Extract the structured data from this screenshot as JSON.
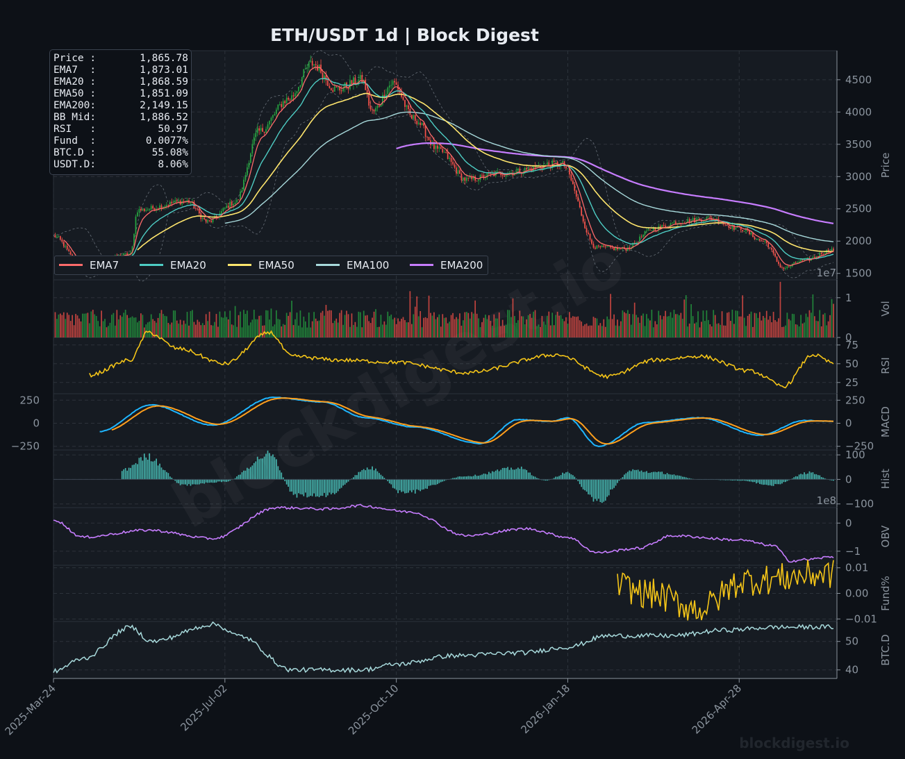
{
  "title": "ETH/USDT  1d  |  Block Digest",
  "watermark": "blockdigest.io",
  "footer": "blockdigest.io",
  "info_box": [
    {
      "key": "Price :",
      "value": "1,865.78"
    },
    {
      "key": "EMA7  :",
      "value": "1,873.01"
    },
    {
      "key": "EMA20 :",
      "value": "1,868.59"
    },
    {
      "key": "EMA50 :",
      "value": "1,851.09"
    },
    {
      "key": "EMA200:",
      "value": "2,149.15"
    },
    {
      "key": "BB Mid:",
      "value": "1,886.52"
    },
    {
      "key": "RSI   :",
      "value": "50.97"
    },
    {
      "key": "Fund  :",
      "value": "0.0077%"
    },
    {
      "key": "BTC.D :",
      "value": "55.08%"
    },
    {
      "key": "USDT.D:",
      "value": "8.06%"
    }
  ],
  "legend": [
    {
      "name": "EMA7",
      "color": "#ff6b6b"
    },
    {
      "name": "EMA20",
      "color": "#4ecdc4"
    },
    {
      "name": "EMA50",
      "color": "#ffe66d"
    },
    {
      "name": "EMA100",
      "color": "#a8dadc"
    },
    {
      "name": "EMA200",
      "color": "#c77dff"
    }
  ],
  "colors": {
    "up": "#26a641",
    "down": "#f85149",
    "rsi": "#f5c518",
    "macd": "#1fb6ff",
    "signal": "#ff9f1c",
    "hist": "#4ecdc4",
    "obv": "#c77dff",
    "funding": "#f5c518",
    "btcd": "#a8dadc",
    "grid": "#2d333b",
    "axis": "#8b949e",
    "panel": "#161b22",
    "background": "#0d1117"
  },
  "chart_data": {
    "type": "candlestick",
    "symbol": "ETH/USDT",
    "interval": "1d",
    "x_ticks": [
      "2025-Mar-24",
      "2025-Jul-02",
      "2025-Oct-10",
      "2026-Jan-18",
      "2026-Apr-28"
    ],
    "x_start": "2025-03-24",
    "x_end": "2026-06-22",
    "price_anchors": [
      [
        "2025-03-24",
        2080
      ],
      [
        "2025-04-10",
        1600
      ],
      [
        "2025-05-08",
        1800
      ],
      [
        "2025-05-12",
        2480
      ],
      [
        "2025-06-10",
        2620
      ],
      [
        "2025-06-22",
        2300
      ],
      [
        "2025-07-08",
        2600
      ],
      [
        "2025-07-22",
        3700
      ],
      [
        "2025-08-08",
        4200
      ],
      [
        "2025-08-22",
        4750
      ],
      [
        "2025-09-05",
        4350
      ],
      [
        "2025-09-20",
        4500
      ],
      [
        "2025-09-26",
        4000
      ],
      [
        "2025-10-08",
        4450
      ],
      [
        "2025-10-20",
        3900
      ],
      [
        "2025-11-04",
        3400
      ],
      [
        "2025-11-20",
        2950
      ],
      [
        "2025-12-10",
        3050
      ],
      [
        "2026-01-14",
        3200
      ],
      [
        "2026-02-04",
        1900
      ],
      [
        "2026-02-20",
        1880
      ],
      [
        "2026-03-10",
        2200
      ],
      [
        "2026-03-24",
        2300
      ],
      [
        "2026-04-10",
        2350
      ],
      [
        "2026-04-28",
        2200
      ],
      [
        "2026-05-12",
        2000
      ],
      [
        "2026-05-24",
        1580
      ],
      [
        "2026-06-04",
        1700
      ],
      [
        "2026-06-22",
        1866
      ]
    ],
    "panels": [
      {
        "name": "Price",
        "ylabel": "Price",
        "yticks": [
          1500,
          2000,
          2500,
          3000,
          3500,
          4000,
          4500
        ],
        "ylim": [
          1400,
          4950
        ],
        "series": [
          "Candles",
          "EMA7",
          "EMA20",
          "EMA50",
          "EMA100",
          "EMA200",
          "Bollinger Bands"
        ]
      },
      {
        "name": "Vol",
        "ylabel": "Vol",
        "yticks": [
          0,
          1
        ],
        "ylim": [
          0,
          1.45
        ],
        "offset": "1e7"
      },
      {
        "name": "RSI",
        "ylabel": "RSI",
        "yticks": [
          25,
          50,
          75
        ],
        "ylim": [
          10,
          85
        ],
        "anchors": [
          [
            "2025-04-14",
            35
          ],
          [
            "2025-05-08",
            55
          ],
          [
            "2025-05-18",
            92
          ],
          [
            "2025-06-05",
            70
          ],
          [
            "2025-07-02",
            50
          ],
          [
            "2025-07-28",
            92
          ],
          [
            "2025-08-10",
            60
          ],
          [
            "2025-09-05",
            55
          ],
          [
            "2025-10-10",
            52
          ],
          [
            "2025-11-20",
            38
          ],
          [
            "2026-01-12",
            62
          ],
          [
            "2026-02-10",
            33
          ],
          [
            "2026-03-10",
            55
          ],
          [
            "2026-04-05",
            60
          ],
          [
            "2026-05-05",
            40
          ],
          [
            "2026-05-24",
            20
          ],
          [
            "2026-06-10",
            62
          ],
          [
            "2026-06-22",
            51
          ]
        ]
      },
      {
        "name": "MACD",
        "ylabel": "MACD",
        "yticks": [
          -250,
          0,
          250
        ],
        "ylim": [
          -290,
          320
        ],
        "series_names": [
          "MACD",
          "Signal"
        ],
        "anchors": [
          [
            "2025-04-20",
            -90
          ],
          [
            "2025-05-20",
            200
          ],
          [
            "2025-06-25",
            -20
          ],
          [
            "2025-07-30",
            280
          ],
          [
            "2025-08-28",
            230
          ],
          [
            "2025-09-22",
            60
          ],
          [
            "2025-10-20",
            -40
          ],
          [
            "2025-11-28",
            -220
          ],
          [
            "2025-12-20",
            40
          ],
          [
            "2026-01-08",
            20
          ],
          [
            "2026-01-18",
            60
          ],
          [
            "2026-02-05",
            -250
          ],
          [
            "2026-03-05",
            10
          ],
          [
            "2026-04-05",
            60
          ],
          [
            "2026-05-10",
            -130
          ],
          [
            "2026-06-05",
            30
          ],
          [
            "2026-06-22",
            20
          ]
        ]
      },
      {
        "name": "Hist",
        "ylabel": "Hist",
        "yticks": [
          -100,
          0,
          100
        ],
        "ylim": [
          -115,
          120
        ],
        "anchors": [
          [
            "2025-05-03",
            40
          ],
          [
            "2025-05-18",
            100
          ],
          [
            "2025-06-08",
            -25
          ],
          [
            "2025-07-02",
            -10
          ],
          [
            "2025-07-28",
            110
          ],
          [
            "2025-08-12",
            -70
          ],
          [
            "2025-08-30",
            -70
          ],
          [
            "2025-09-25",
            50
          ],
          [
            "2025-10-14",
            -60
          ],
          [
            "2025-11-20",
            15
          ],
          [
            "2025-12-20",
            50
          ],
          [
            "2026-01-05",
            -5
          ],
          [
            "2026-01-18",
            30
          ],
          [
            "2026-02-04",
            -100
          ],
          [
            "2026-02-25",
            40
          ],
          [
            "2026-03-12",
            30
          ],
          [
            "2026-04-05",
            0
          ],
          [
            "2026-04-28",
            -5
          ],
          [
            "2026-05-18",
            -25
          ],
          [
            "2026-06-08",
            30
          ],
          [
            "2026-06-22",
            -5
          ]
        ]
      },
      {
        "name": "OBV",
        "ylabel": "OBV",
        "yticks": [
          -1,
          0
        ],
        "ylim": [
          -1.5,
          0.55
        ],
        "offset": "1e8",
        "anchors": [
          [
            "2025-03-24",
            0.12
          ],
          [
            "2025-04-10",
            -0.5
          ],
          [
            "2025-05-18",
            -0.25
          ],
          [
            "2025-06-25",
            -0.55
          ],
          [
            "2025-08-01",
            0.55
          ],
          [
            "2025-09-01",
            0.5
          ],
          [
            "2025-09-18",
            0.62
          ],
          [
            "2025-10-18",
            0.4
          ],
          [
            "2025-11-20",
            -0.45
          ],
          [
            "2025-12-25",
            -0.2
          ],
          [
            "2026-01-18",
            -0.5
          ],
          [
            "2026-02-04",
            -1.05
          ],
          [
            "2026-02-28",
            -0.9
          ],
          [
            "2026-03-20",
            -0.45
          ],
          [
            "2026-04-28",
            -0.6
          ],
          [
            "2026-05-18",
            -0.8
          ],
          [
            "2026-05-28",
            -1.35
          ],
          [
            "2026-06-05",
            -1.3
          ],
          [
            "2026-06-22",
            -1.2
          ]
        ]
      },
      {
        "name": "Fund%",
        "ylabel": "Fund%",
        "yticks": [
          -0.01,
          0.0,
          0.01
        ],
        "ylim": [
          -0.011,
          0.011
        ],
        "start": "2026-02-16",
        "anchors": [
          [
            "2026-02-16",
            0.003
          ],
          [
            "2026-03-05",
            0.0
          ],
          [
            "2026-04-05",
            -0.006
          ],
          [
            "2026-05-01",
            0.005
          ],
          [
            "2026-06-22",
            0.0077
          ]
        ]
      },
      {
        "name": "BTC.D",
        "ylabel": "BTC.D",
        "yticks": [
          40,
          50
        ],
        "ylim": [
          37,
          57
        ],
        "anchors": [
          [
            "2025-03-24",
            39.5
          ],
          [
            "2025-04-10",
            44
          ],
          [
            "2025-05-08",
            55
          ],
          [
            "2025-05-20",
            50
          ],
          [
            "2025-06-26",
            56
          ],
          [
            "2025-07-10",
            52
          ],
          [
            "2025-08-10",
            40
          ],
          [
            "2025-09-20",
            40
          ],
          [
            "2025-10-10",
            42
          ],
          [
            "2025-11-12",
            45
          ],
          [
            "2025-12-22",
            46
          ],
          [
            "2026-01-18",
            48
          ],
          [
            "2026-02-10",
            52
          ],
          [
            "2026-03-20",
            52
          ],
          [
            "2026-04-20",
            54
          ],
          [
            "2026-05-20",
            55
          ],
          [
            "2026-06-22",
            55.08
          ]
        ]
      }
    ]
  }
}
